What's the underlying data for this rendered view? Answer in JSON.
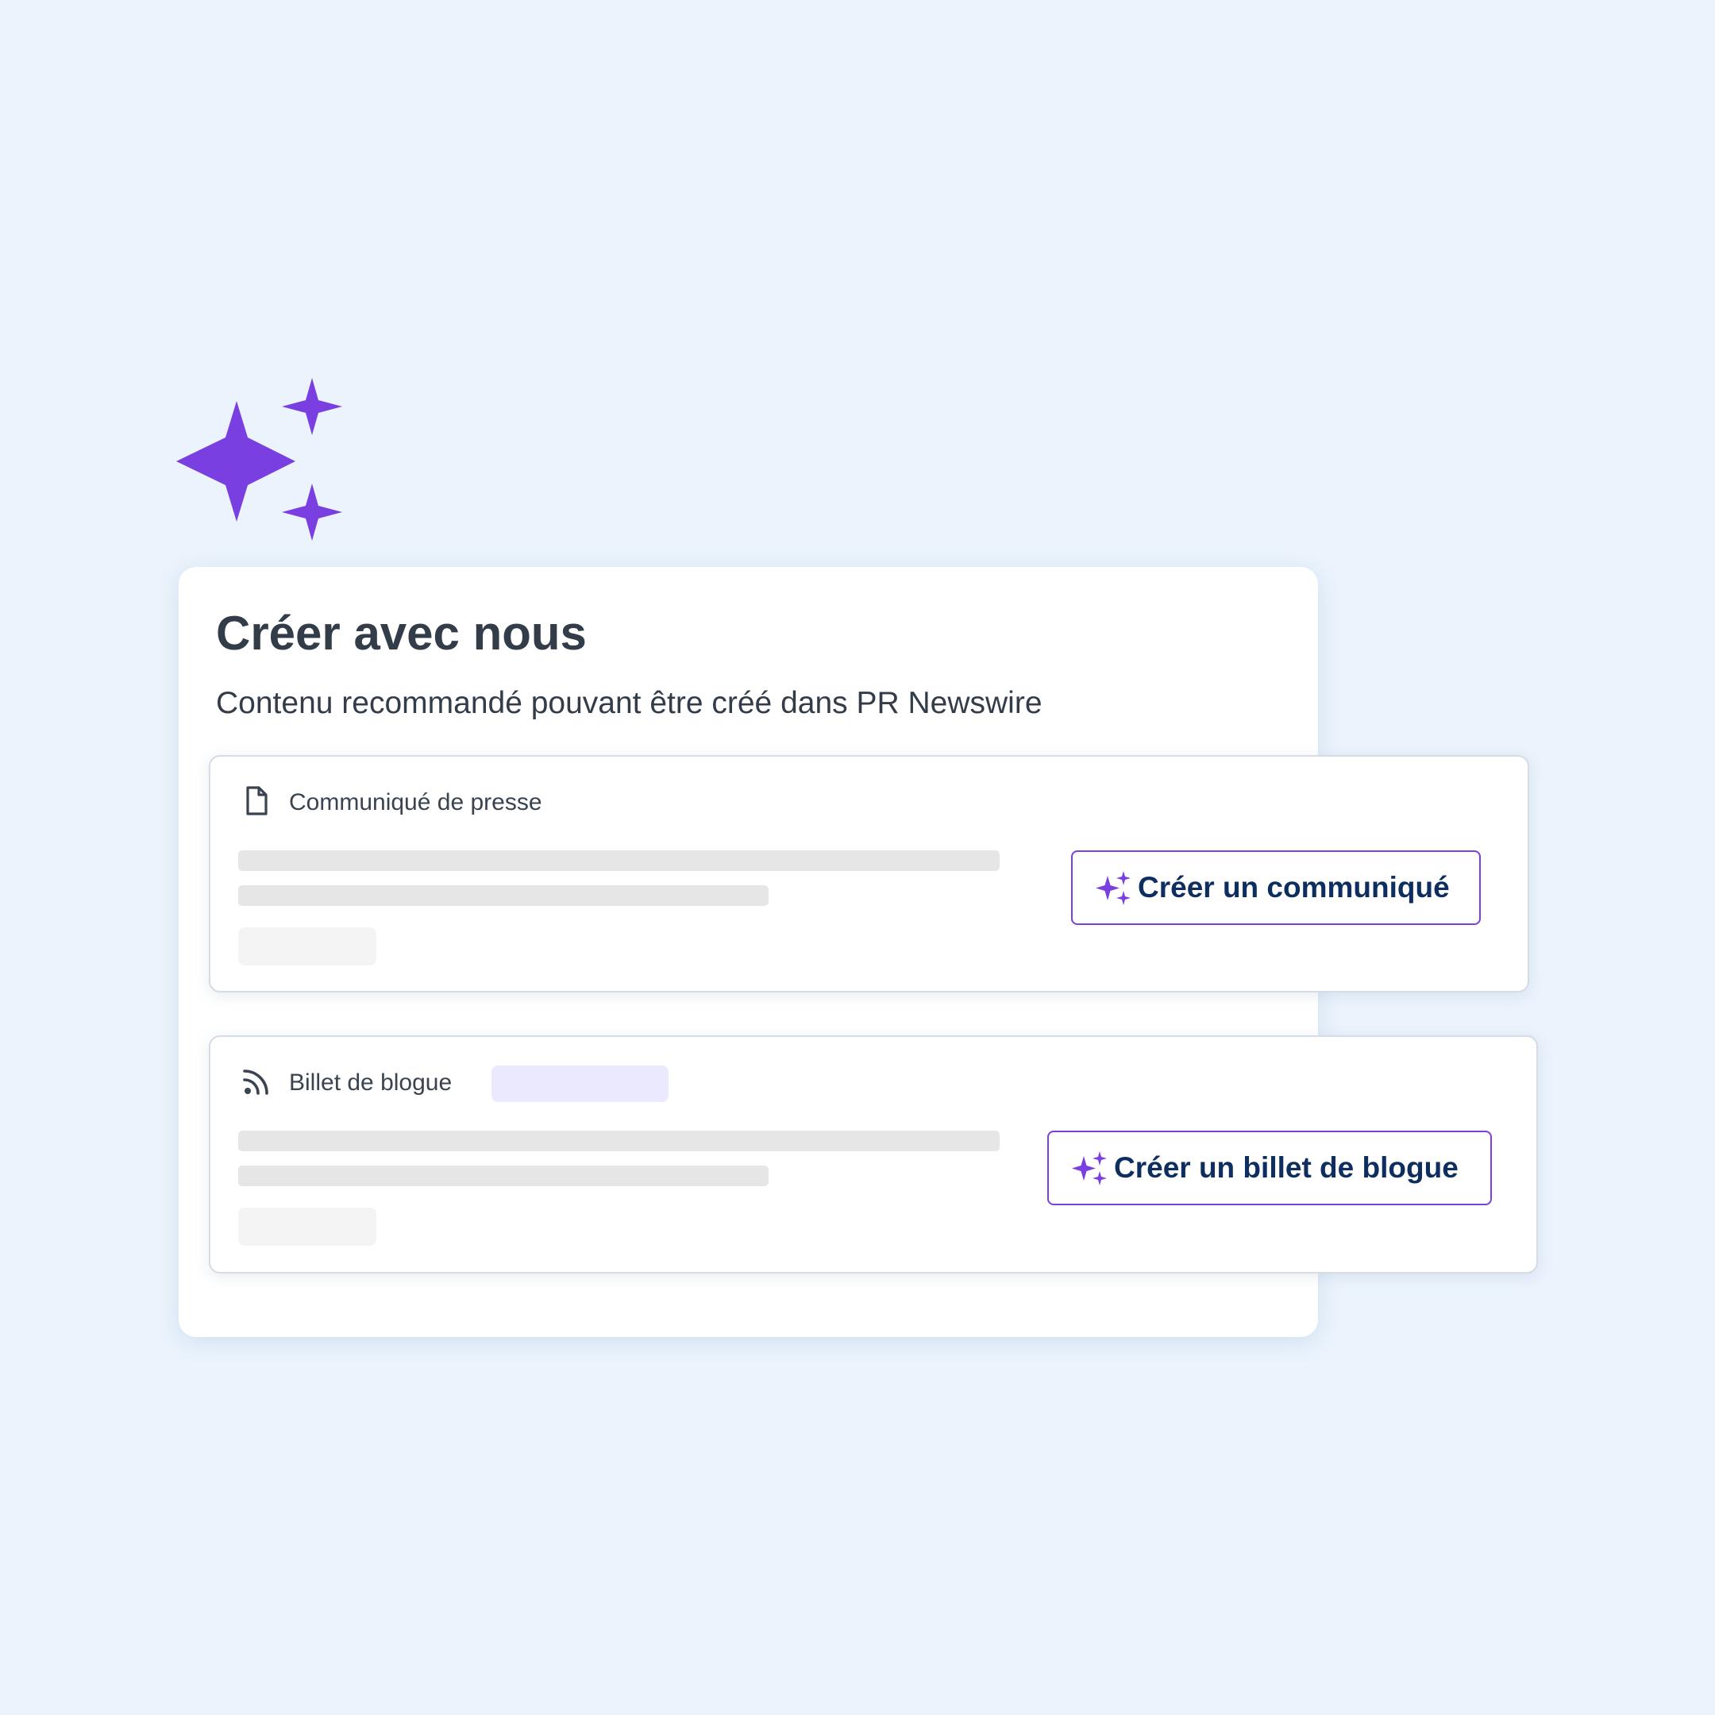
{
  "colors": {
    "background": "#EBF3FC",
    "accent_purple": "#7A3FE0",
    "title_text": "#333D49",
    "button_text": "#0D2E5E"
  },
  "decor": {
    "icon": "sparkles-icon"
  },
  "panel": {
    "title": "Créer avec nous",
    "subtitle": "Contenu recommandé pouvant être créé dans PR Newswire"
  },
  "cards": [
    {
      "icon": "document-icon",
      "label": "Communiqué de presse",
      "button_icon": "sparkles-icon",
      "button_label": "Créer un communiqué"
    },
    {
      "icon": "rss-icon",
      "label": "Billet de blogue",
      "button_icon": "sparkles-icon",
      "button_label": "Créer un billet de blogue"
    }
  ]
}
